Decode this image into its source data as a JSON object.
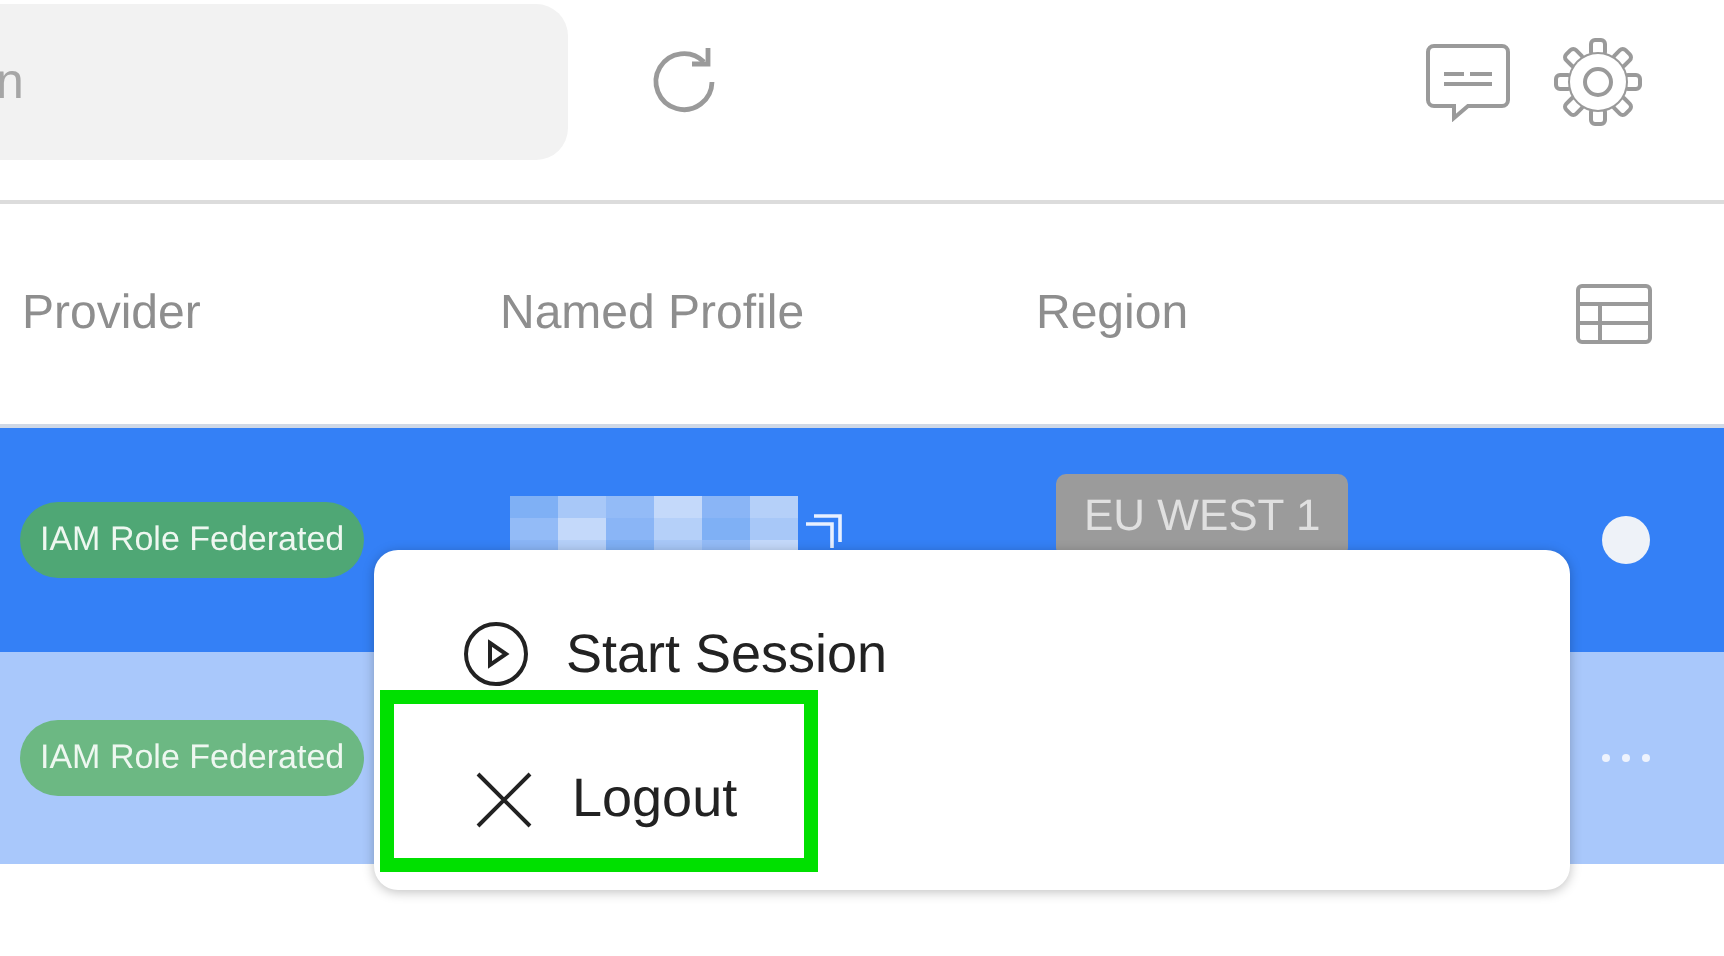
{
  "search": {
    "placeholder": "n"
  },
  "table": {
    "columns": [
      "Provider",
      "Named Profile",
      "Region"
    ],
    "rows": [
      {
        "provider": "IAM Role Federated",
        "region": "EU WEST 1",
        "active": true
      },
      {
        "provider": "IAM Role Federated",
        "active": false
      }
    ]
  },
  "context_menu": {
    "items": [
      {
        "kind": "start",
        "label": "Start Session",
        "highlighted": false
      },
      {
        "kind": "logout",
        "label": "Logout",
        "highlighted": true
      }
    ]
  }
}
